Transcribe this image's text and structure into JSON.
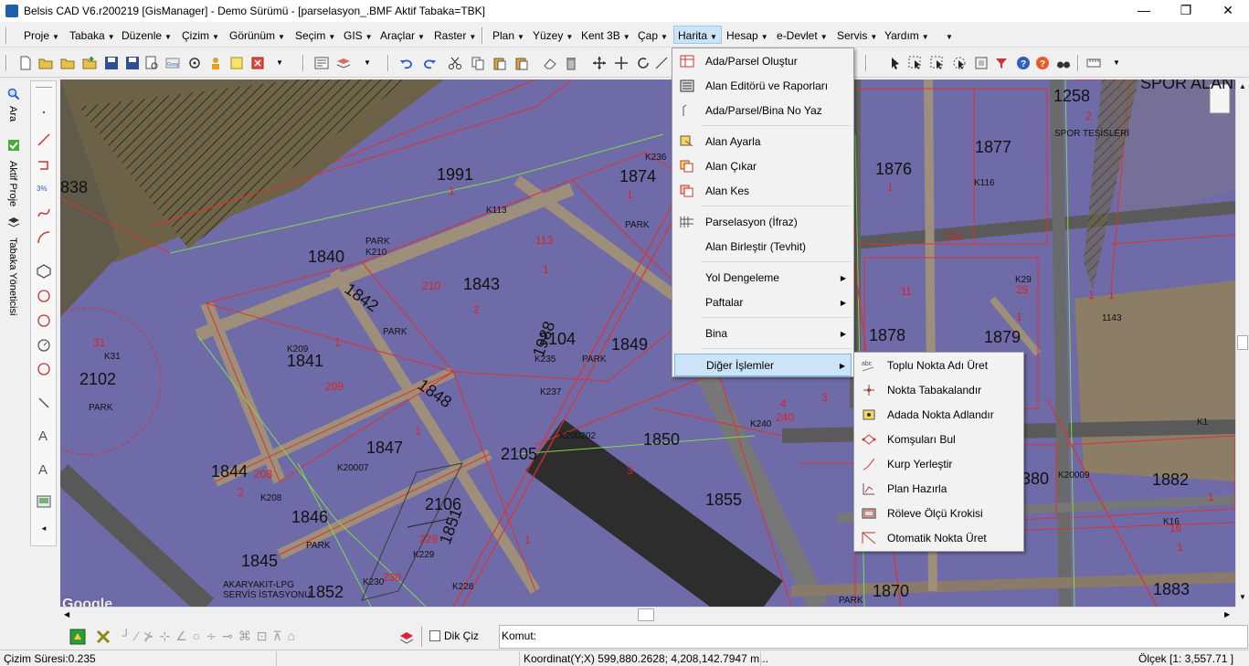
{
  "window": {
    "title": "Belsis CAD V6.r200219 [GisManager] - Demo Sürümü - [parselasyon_.BMF  Aktif Tabaka=TBK]",
    "minimize": "—",
    "maximize": "❐",
    "close": "✕"
  },
  "menu": [
    {
      "label": "Proje"
    },
    {
      "label": "Tabaka"
    },
    {
      "label": "Düzenle"
    },
    {
      "label": "Çizim"
    },
    {
      "label": "Görünüm"
    },
    {
      "label": "Seçim"
    },
    {
      "label": "GIS"
    },
    {
      "label": "Araçlar"
    },
    {
      "label": "Raster"
    },
    {
      "label": "Plan"
    },
    {
      "label": "Yüzey"
    },
    {
      "label": "Kent 3B"
    },
    {
      "label": "Çap"
    },
    {
      "label": "Harita"
    },
    {
      "label": "Hesap"
    },
    {
      "label": "e-Devlet"
    },
    {
      "label": "Servis"
    },
    {
      "label": "Yardım"
    }
  ],
  "left_tabs": {
    "search": "Ara",
    "active_project": "Aktif Proje",
    "layer_manager": "Tabaka Yöneticisi"
  },
  "harita_menu": [
    {
      "label": "Ada/Parsel Oluştur",
      "icon": "parcel-create-icon"
    },
    {
      "label": "Alan Editörü ve Raporları",
      "icon": "area-editor-icon"
    },
    {
      "label": "Ada/Parsel/Bina No Yaz",
      "icon": "number-write-icon"
    },
    {
      "label": "Alan Ayarla",
      "icon": "area-adjust-icon"
    },
    {
      "label": "Alan Çıkar",
      "icon": "area-subtract-icon"
    },
    {
      "label": "Alan Kes",
      "icon": "area-cut-icon"
    },
    {
      "label": "Parselasyon (İfraz)",
      "icon": "parcelation-icon"
    },
    {
      "label": "Alan Birleştir (Tevhit)",
      "icon": ""
    },
    {
      "label": "Yol Dengeleme",
      "icon": ""
    },
    {
      "label": "Paftalar",
      "icon": ""
    },
    {
      "label": "Bina",
      "icon": ""
    },
    {
      "label": "Diğer İşlemler",
      "icon": ""
    }
  ],
  "submenu": [
    {
      "label": "Toplu Nokta Adı Üret",
      "icon": "abc-icon"
    },
    {
      "label": "Nokta Tabakalandır",
      "icon": "point-layer-icon"
    },
    {
      "label": "Adada Nokta Adlandır",
      "icon": "block-point-icon"
    },
    {
      "label": "Komşuları Bul",
      "icon": "neighbors-icon"
    },
    {
      "label": "Kurp Yerleştir",
      "icon": "curve-icon"
    },
    {
      "label": "Plan Hazırla",
      "icon": "plan-icon"
    },
    {
      "label": "Röleve Ölçü Krokisi",
      "icon": "sketch-icon"
    },
    {
      "label": "Otomatik Nokta Üret",
      "icon": "auto-point-icon"
    }
  ],
  "map": {
    "watermark": "Google",
    "labels": [
      {
        "t": "1991",
        "k": "big"
      },
      {
        "t": "1",
        "k": "red"
      },
      {
        "t": "1874",
        "k": "big"
      },
      {
        "t": "1",
        "k": "red"
      },
      {
        "t": "PARK",
        "k": "small"
      },
      {
        "t": "K236",
        "k": "small"
      },
      {
        "t": "1876",
        "k": "big"
      },
      {
        "t": "1",
        "k": "red"
      },
      {
        "t": "1877",
        "k": "big"
      },
      {
        "t": "K116",
        "k": "small"
      },
      {
        "t": "1258",
        "k": "big"
      },
      {
        "t": "2",
        "k": "red"
      },
      {
        "t": "SPOR TESİSLERİ",
        "k": "small"
      },
      {
        "t": "SPOR ALANI",
        "k": "big"
      },
      {
        "t": "838",
        "k": "big"
      },
      {
        "t": "K113",
        "k": "small"
      },
      {
        "t": "1840",
        "k": "big"
      },
      {
        "t": "K210",
        "k": "small"
      },
      {
        "t": "PARK",
        "k": "small"
      },
      {
        "t": "113",
        "k": "red"
      },
      {
        "t": "1",
        "k": "red"
      },
      {
        "t": "1843",
        "k": "big"
      },
      {
        "t": "210",
        "k": "red"
      },
      {
        "t": "2",
        "k": "red"
      },
      {
        "t": "1842",
        "k": "big"
      },
      {
        "t": "PARK",
        "k": "small"
      },
      {
        "t": "K29",
        "k": "small"
      },
      {
        "t": "29",
        "k": "red"
      },
      {
        "t": "1143",
        "k": "small"
      },
      {
        "t": "1878",
        "k": "big"
      },
      {
        "t": "1879",
        "k": "big"
      },
      {
        "t": "1",
        "k": "red"
      },
      {
        "t": "1",
        "k": "red"
      },
      {
        "t": "1",
        "k": "red"
      },
      {
        "t": "31",
        "k": "red"
      },
      {
        "t": "K31",
        "k": "small"
      },
      {
        "t": "2102",
        "k": "big"
      },
      {
        "t": "PARK",
        "k": "small"
      },
      {
        "t": "K209",
        "k": "small"
      },
      {
        "t": "1841",
        "k": "big"
      },
      {
        "t": "209",
        "k": "red"
      },
      {
        "t": "1",
        "k": "red"
      },
      {
        "t": "2104",
        "k": "big"
      },
      {
        "t": "K235",
        "k": "small"
      },
      {
        "t": "PARK",
        "k": "small"
      },
      {
        "t": "K237",
        "k": "small"
      },
      {
        "t": "1988",
        "k": "big"
      },
      {
        "t": "1849",
        "k": "big"
      },
      {
        "t": "1848",
        "k": "big"
      },
      {
        "t": "1",
        "k": "red"
      },
      {
        "t": "1847",
        "k": "big"
      },
      {
        "t": "K20007",
        "k": "small"
      },
      {
        "t": "2105",
        "k": "big"
      },
      {
        "t": "K200202",
        "k": "small"
      },
      {
        "t": "1850",
        "k": "big"
      },
      {
        "t": "3",
        "k": "red"
      },
      {
        "t": "K240",
        "k": "small"
      },
      {
        "t": "4",
        "k": "red"
      },
      {
        "t": "240",
        "k": "red"
      },
      {
        "t": "3",
        "k": "red"
      },
      {
        "t": "1844",
        "k": "big"
      },
      {
        "t": "208",
        "k": "red"
      },
      {
        "t": "K208",
        "k": "small"
      },
      {
        "t": "2",
        "k": "red"
      },
      {
        "t": "1846",
        "k": "big"
      },
      {
        "t": "PARK",
        "k": "small"
      },
      {
        "t": "2106",
        "k": "big"
      },
      {
        "t": "1851",
        "k": "big"
      },
      {
        "t": "1855",
        "k": "big"
      },
      {
        "t": "1",
        "k": "red"
      },
      {
        "t": "1845",
        "k": "big"
      },
      {
        "t": "K229",
        "k": "small"
      },
      {
        "t": "229",
        "k": "red"
      },
      {
        "t": "K228",
        "k": "small"
      },
      {
        "t": "K230",
        "k": "small"
      },
      {
        "t": "230",
        "k": "red"
      },
      {
        "t": "1852",
        "k": "big"
      },
      {
        "t": "AKARYAKIT-LPG",
        "k": "small"
      },
      {
        "t": "SERVİS İSTASYONU",
        "k": "small"
      },
      {
        "t": "380",
        "k": "big"
      },
      {
        "t": "K20009",
        "k": "small"
      },
      {
        "t": "1882",
        "k": "big"
      },
      {
        "t": "K16",
        "k": "small"
      },
      {
        "t": "16",
        "k": "red"
      },
      {
        "t": "1883",
        "k": "big"
      },
      {
        "t": "1870",
        "k": "big"
      },
      {
        "t": "PARK",
        "k": "small"
      },
      {
        "t": "K1",
        "k": "small"
      },
      {
        "t": "116",
        "k": "red"
      },
      {
        "t": "1",
        "k": "red"
      },
      {
        "t": "1",
        "k": "red"
      },
      {
        "t": "1",
        "k": "red"
      },
      {
        "t": "1",
        "k": "red"
      }
    ]
  },
  "bottom": {
    "dik_ciz": "Dik Çiz",
    "komut": "Komut:"
  },
  "status": {
    "time": "Çizim Süresi:0.235",
    "coord": "Koordinat(Y;X)  599,880.2628; 4,208,142.7947 m...",
    "scale": "Ölçek [1: 3,557.71 ]"
  }
}
